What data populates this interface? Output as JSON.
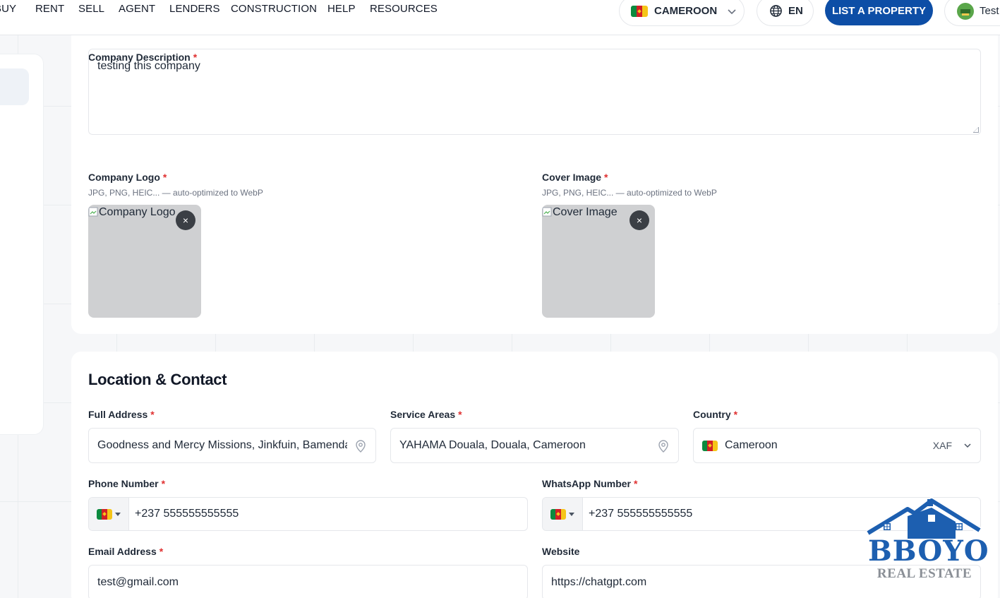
{
  "nav": {
    "links": [
      "BUY",
      "RENT",
      "SELL",
      "AGENT",
      "LENDERS",
      "CONSTRUCTION",
      "HELP",
      "RESOURCES"
    ],
    "country": "CAMEROON",
    "language": "EN",
    "list_button": "LIST A PROPERTY",
    "user_name": "Test"
  },
  "company": {
    "description_label": "Company Description",
    "description_value": "testing this company",
    "logo_label": "Company Logo",
    "logo_hint": "JPG, PNG, HEIC... — auto-optimized to WebP",
    "logo_alt": "Company Logo",
    "cover_label": "Cover Image",
    "cover_hint": "JPG, PNG, HEIC... — auto-optimized to WebP",
    "cover_alt": "Cover Image",
    "remove_symbol": "×",
    "required_mark": "*"
  },
  "location": {
    "title": "Location & Contact",
    "address_label": "Full Address",
    "address_value": "Goodness and Mercy Missions, Jinkfuin, Bamenda",
    "service_label": "Service Areas",
    "service_value": "YAHAMA Douala, Douala, Cameroon",
    "country_label": "Country",
    "country_value": "Cameroon",
    "currency": "XAF",
    "phone_label": "Phone Number",
    "phone_value": "+237 555555555555",
    "whatsapp_label": "WhatsApp Number",
    "whatsapp_value": "+237 555555555555",
    "email_label": "Email Address",
    "email_value": "test@gmail.com",
    "website_label": "Website",
    "website_value": "https://chatgpt.com"
  },
  "watermark": {
    "brand": "BBOYO",
    "tagline": "REAL ESTATE"
  },
  "colors": {
    "primary": "#0d4ea6",
    "required": "#e03131",
    "brand_blue": "#1d5fb0"
  }
}
